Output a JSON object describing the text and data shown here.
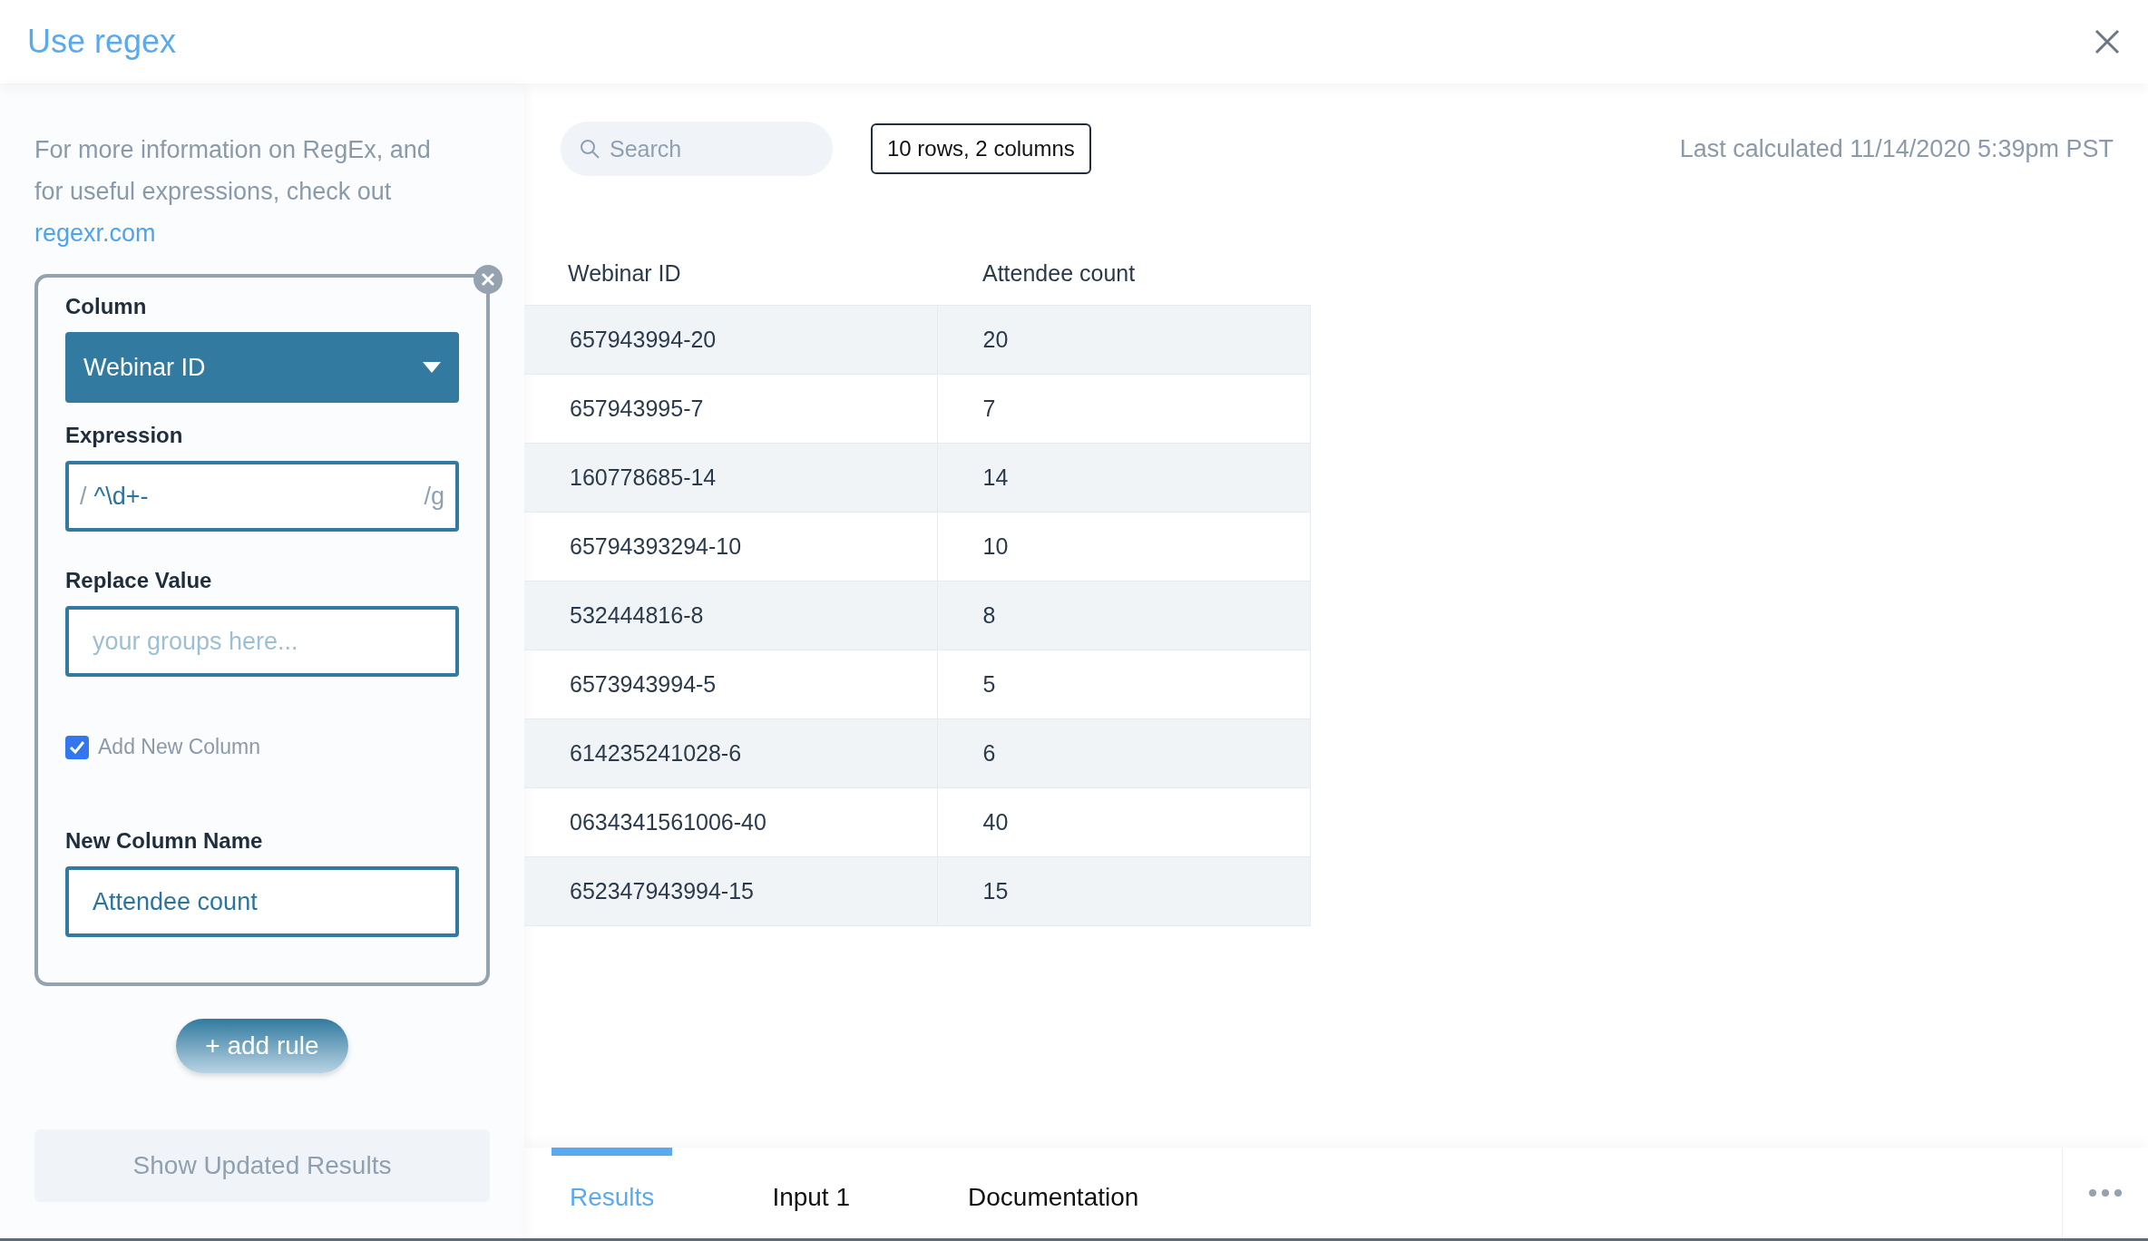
{
  "dialog": {
    "title": "Use regex"
  },
  "sidebar": {
    "info_text": "For more information on RegEx, and for useful expressions, check out",
    "info_link": "regexr.com",
    "rule": {
      "column_label": "Column",
      "column_value": "Webinar ID",
      "expression_label": "Expression",
      "expression_prefix": "/",
      "expression_value": "^\\d+-",
      "expression_suffix": "/g",
      "replace_label": "Replace Value",
      "replace_placeholder": "your groups here...",
      "add_column_label": "Add New Column",
      "add_column_checked": true,
      "new_column_label": "New Column Name",
      "new_column_value": "Attendee count"
    },
    "add_rule_button": "+ add rule",
    "show_results_button": "Show Updated Results"
  },
  "toolbar": {
    "search_placeholder": "Search",
    "size_badge": "10 rows, 2 columns",
    "last_calculated": "Last calculated 11/14/2020 5:39pm PST"
  },
  "table": {
    "columns": [
      "Webinar ID",
      "Attendee count"
    ],
    "rows": [
      [
        "657943994-20",
        "20"
      ],
      [
        "657943995-7",
        "7"
      ],
      [
        "160778685-14",
        "14"
      ],
      [
        "65794393294-10",
        "10"
      ],
      [
        "532444816-8",
        "8"
      ],
      [
        "6573943994-5",
        "5"
      ],
      [
        "614235241028-6",
        "6"
      ],
      [
        "0634341561006-40",
        "40"
      ],
      [
        "652347943994-15",
        "15"
      ]
    ]
  },
  "tabs": [
    {
      "label": "Results",
      "selected": true
    },
    {
      "label": "Input 1",
      "selected": false
    },
    {
      "label": "Documentation",
      "selected": false
    }
  ]
}
